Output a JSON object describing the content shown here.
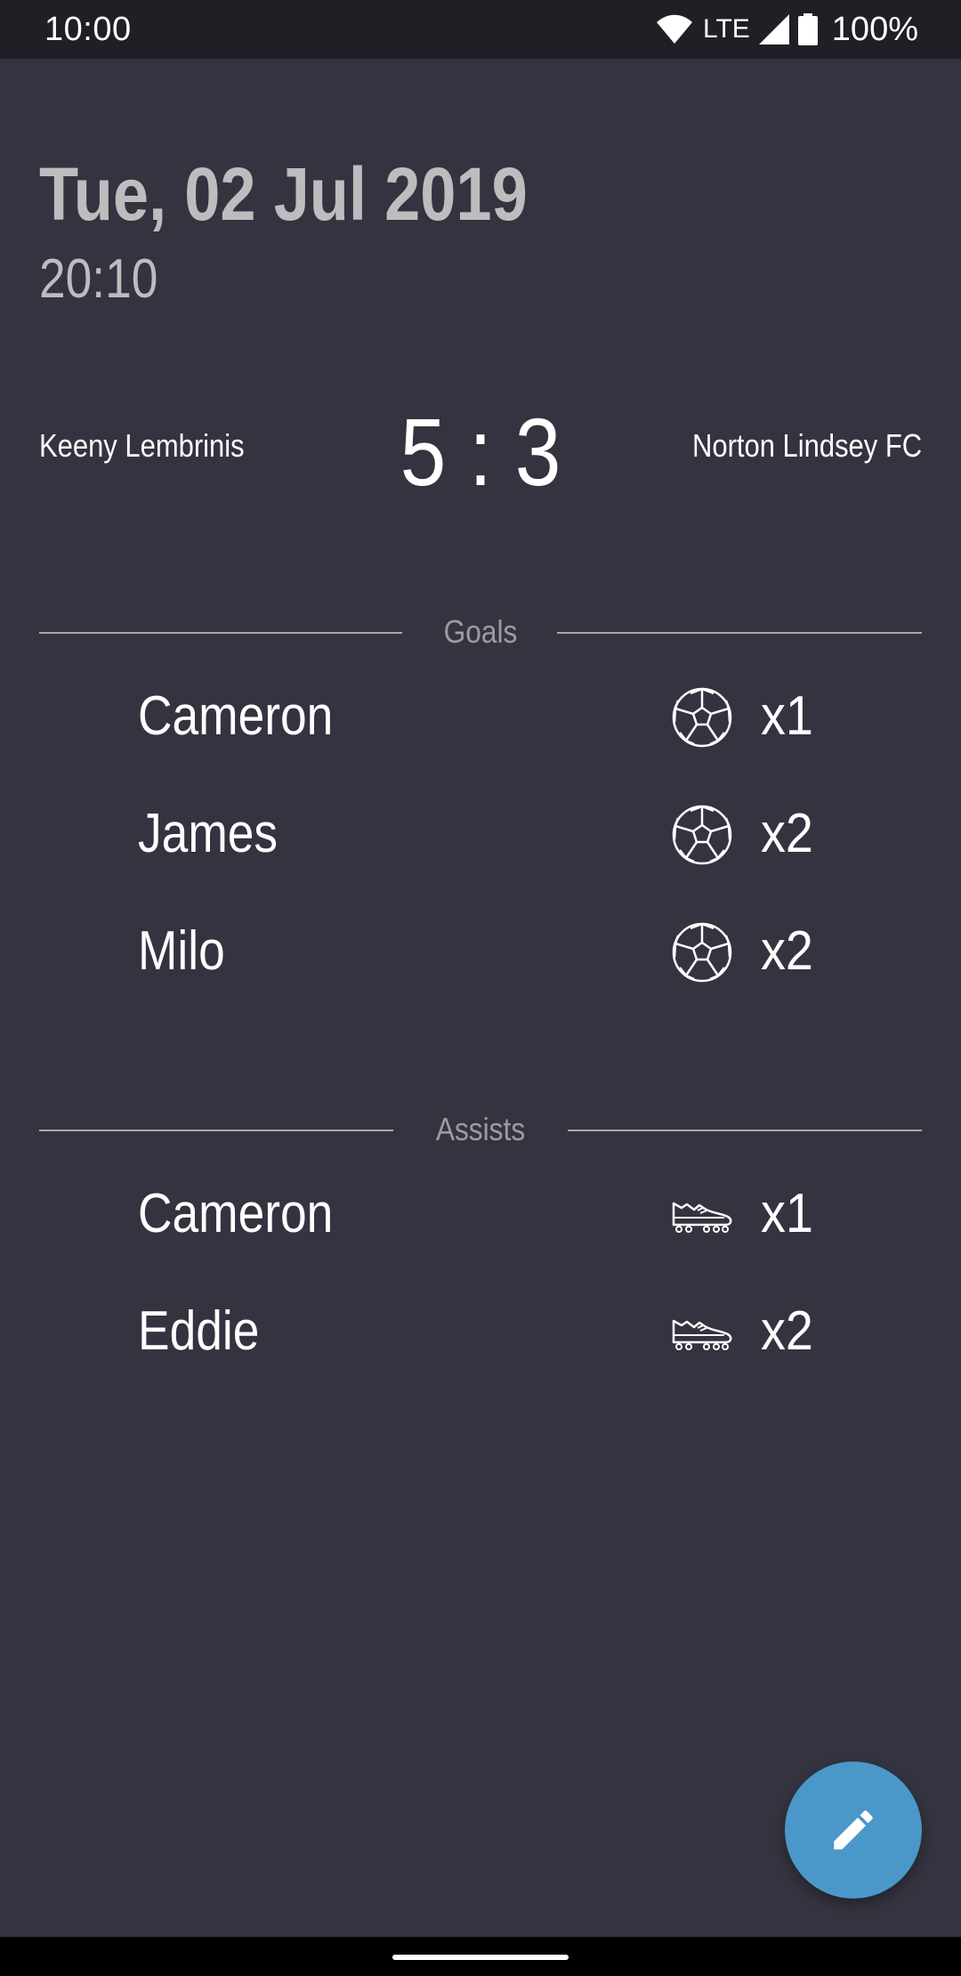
{
  "status_bar": {
    "time": "10:00",
    "network": "LTE",
    "battery": "100%",
    "icons": [
      "wifi-icon",
      "cell-signal-icon",
      "battery-icon"
    ]
  },
  "match": {
    "date": "Tue, 02 Jul 2019",
    "time": "20:10",
    "home_team": "Keeny Lembrinis",
    "away_team": "Norton Lindsey FC",
    "score": "5 : 3"
  },
  "goals": {
    "title": "Goals",
    "icon": "soccer-ball-icon",
    "rows": [
      {
        "name": "Cameron",
        "count": "x1"
      },
      {
        "name": "James",
        "count": "x2"
      },
      {
        "name": "Milo",
        "count": "x2"
      }
    ]
  },
  "assists": {
    "title": "Assists",
    "icon": "football-boot-icon",
    "rows": [
      {
        "name": "Cameron",
        "count": "x1"
      },
      {
        "name": "Eddie",
        "count": "x2"
      }
    ]
  },
  "fab": {
    "icon": "pencil-edit-icon",
    "color": "#4a98c9"
  },
  "colors": {
    "background": "#343440",
    "status_bar": "#1f1f25",
    "muted_text": "#bdbdbf",
    "divider": "#a9a9ae"
  }
}
